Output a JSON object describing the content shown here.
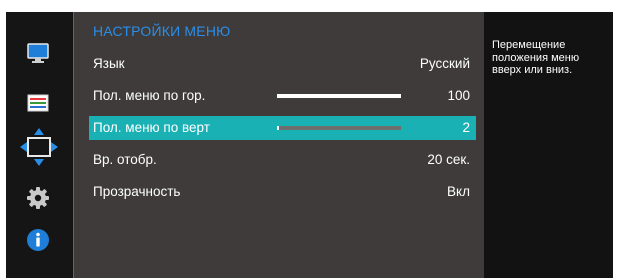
{
  "menu": {
    "title": "НАСТРОЙКИ МЕНЮ",
    "items": [
      {
        "label": "Язык",
        "value": "Русский"
      },
      {
        "label": "Пол. меню по гор.",
        "value": "100",
        "bar_fraction": 1.0
      },
      {
        "label": "Пол. меню по верт",
        "value": "2",
        "bar_fraction": 0.02,
        "selected": true
      },
      {
        "label": "Вр. отобр.",
        "value": "20 сек."
      },
      {
        "label": "Прозрачность",
        "value": "Вкл"
      }
    ]
  },
  "help": {
    "text": "Перемещение положения меню вверх или вниз."
  },
  "sidebar": {
    "icons": [
      "monitor-icon",
      "color-adjust-icon",
      "position-arrows-icon",
      "gear-icon",
      "info-icon"
    ]
  },
  "colors": {
    "title": "#2a8ee8",
    "selected_row": "#1ab1b5",
    "panel": "#3e3b3a"
  }
}
